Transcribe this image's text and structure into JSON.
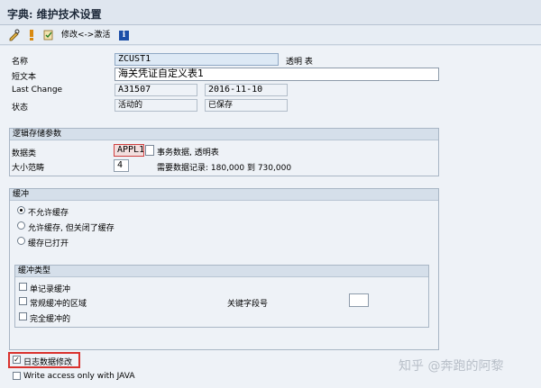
{
  "window": {
    "title": "字典: 维护技术设置"
  },
  "toolbar": {
    "edit_icon": "pencil-glasses-icon",
    "activate_icon": "activate-icon",
    "check_icon": "check-icon",
    "switch_label": "修改<->激活",
    "info_icon": "info-icon",
    "info_glyph": "i"
  },
  "header": {
    "name_label": "名称",
    "name_value": "ZCUST1",
    "name_suffix": "透明 表",
    "short_text_label": "短文本",
    "short_text_value": "海关凭证自定义表1",
    "last_change_label": "Last Change",
    "last_change_user": "A31507",
    "last_change_date": "2016-11-10",
    "status_label": "状态",
    "status_value": "活动的",
    "save_status": "已保存"
  },
  "logical_storage": {
    "title": "逻辑存储参数",
    "data_class_label": "数据类",
    "data_class_value": "APPL1",
    "data_class_desc": "事务数据, 透明表",
    "size_category_label": "大小范畴",
    "size_category_value": "4",
    "size_desc": "需要数据记录: 180,000 到 730,000"
  },
  "buffering": {
    "title": "缓冲",
    "options": [
      {
        "label": "不允许缓存",
        "selected": true
      },
      {
        "label": "允许缓存, 但关闭了缓存",
        "selected": false
      },
      {
        "label": "缓存已打开",
        "selected": false
      }
    ],
    "type_group_title": "缓冲类型",
    "types": [
      {
        "label": "单记录缓冲",
        "checked": false
      },
      {
        "label": "常规缓冲的区域",
        "checked": false
      },
      {
        "label": "完全缓冲的",
        "checked": false
      }
    ],
    "key_fields_label": "关键字段号",
    "key_fields_value": ""
  },
  "footer": {
    "log_changes_label": "日志数据修改",
    "log_changes_checked": true,
    "write_access_label": "Write access only with JAVA",
    "write_access_checked": false
  },
  "watermark": {
    "text": "知乎 @奔跑的阿黎"
  },
  "colors": {
    "highlight_border": "#d9322e",
    "group_header": "#d5dfea",
    "background": "#eef2f7"
  }
}
